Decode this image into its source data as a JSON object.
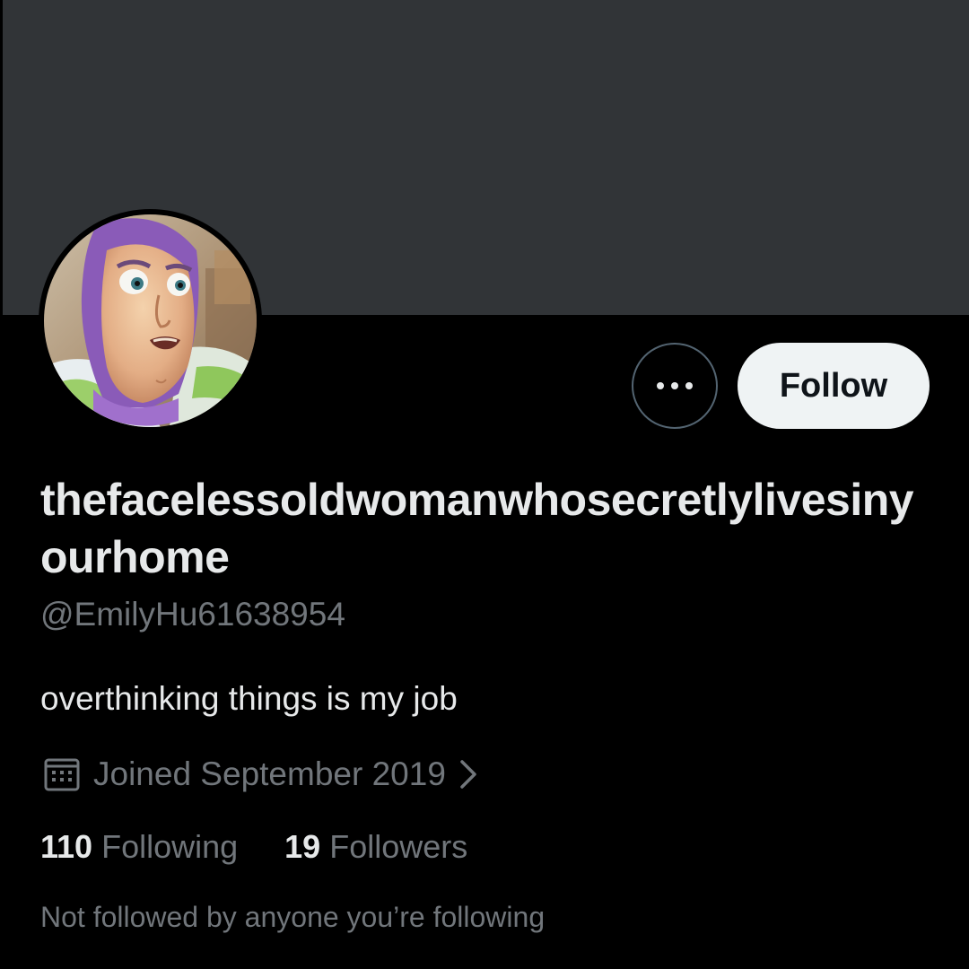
{
  "profile": {
    "display_name": "thefacelessoldwomanwhosecretlylivesinyourhome",
    "handle": "@EmilyHu61638954",
    "bio": "overthinking things is my job",
    "joined": "Joined September 2019",
    "following_count": "110",
    "following_label": "Following",
    "followers_count": "19",
    "followers_label": "Followers",
    "mutuals_note": "Not followed by anyone you’re following"
  },
  "actions": {
    "more_icon": "more-horizontal-icon",
    "follow_label": "Follow"
  },
  "icons": {
    "calendar": "calendar-icon",
    "chevron": "chevron-right-icon"
  },
  "colors": {
    "background": "#000000",
    "banner": "#313437",
    "primary_text": "#e7e9ea",
    "secondary_text": "#71767b",
    "follow_button_bg": "#eff3f4",
    "follow_button_text": "#0f1419",
    "outline": "#536471"
  }
}
